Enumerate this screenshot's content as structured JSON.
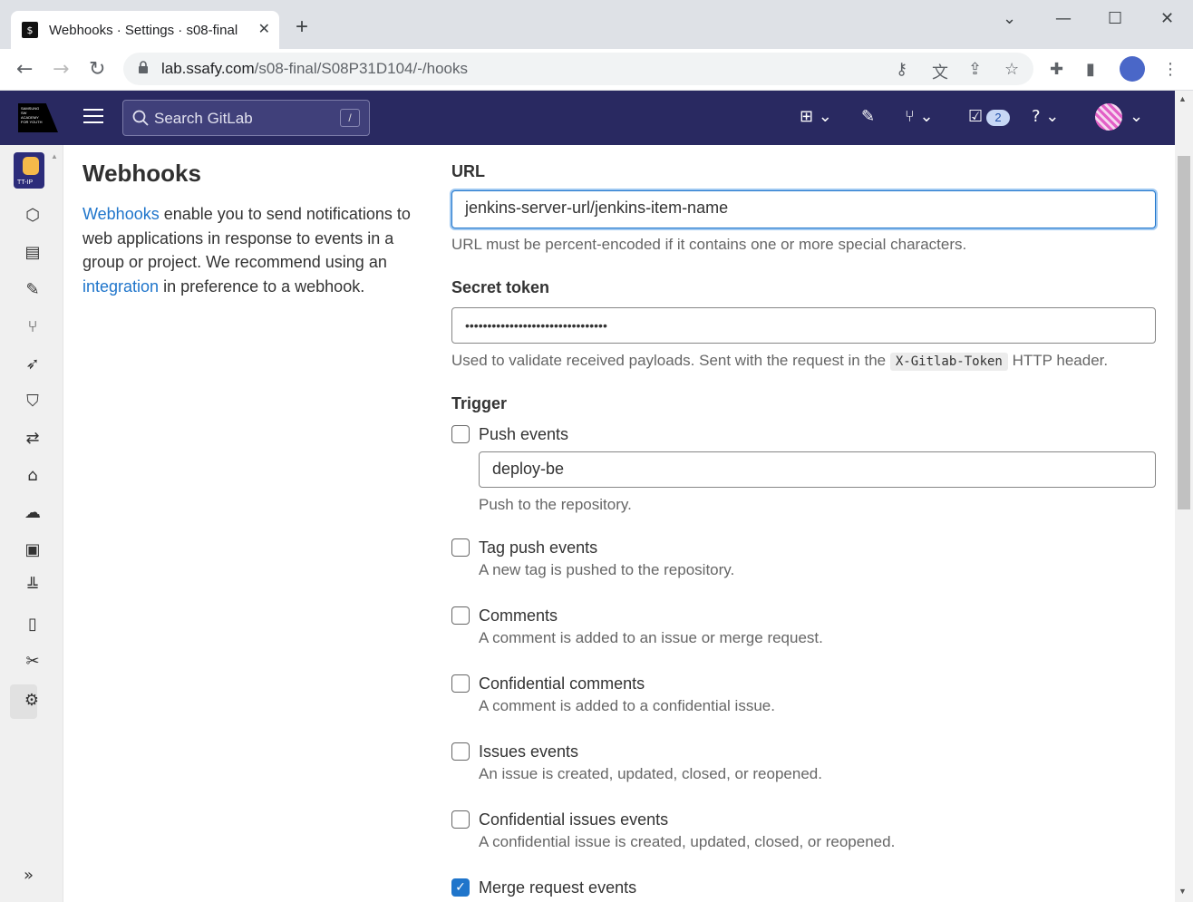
{
  "browser": {
    "tab_title": "Webhooks · Settings · s08-final",
    "tab_favicon_letter": "$",
    "url_host": "lab.ssafy.com",
    "url_path": "/s08-final/S08P31D104/-/hooks"
  },
  "header": {
    "search_placeholder": "Search GitLab",
    "search_shortcut": "/",
    "todo_count": "2",
    "logo_text": "SAMSUNG SW ACADEMY FOR YOUTH"
  },
  "sidebar": {
    "project_avatar_text": "TT-IP",
    "icons": [
      "project-overview-icon",
      "repository-icon",
      "issues-icon",
      "merge-requests-icon",
      "ci-cd-icon",
      "security-icon",
      "deployments-icon",
      "packages-icon",
      "infrastructure-icon",
      "monitor-icon",
      "analytics-icon",
      "wiki-icon",
      "snippets-icon",
      "settings-icon"
    ]
  },
  "intro": {
    "title": "Webhooks",
    "link_webhooks": "Webhooks",
    "text_1": " enable you to send notifications to web applications in response to events in a group or project. We recommend using an ",
    "link_integration": "integration",
    "text_2": " in preference to a webhook."
  },
  "form": {
    "url_label": "URL",
    "url_value": "jenkins-server-url/jenkins-item-name",
    "url_help": "URL must be percent-encoded if it contains one or more special characters.",
    "secret_label": "Secret token",
    "secret_value": "••••••••••••••••••••••••••••••••",
    "secret_help_1": "Used to validate received payloads. Sent with the request in the ",
    "secret_help_code": "X-Gitlab-Token",
    "secret_help_2": " HTTP header.",
    "trigger_label": "Trigger",
    "push_branch_value": "deploy-be",
    "push_help": "Push to the repository.",
    "triggers": [
      {
        "label": "Push events",
        "help": "",
        "checked": false
      },
      {
        "label": "Tag push events",
        "help": "A new tag is pushed to the repository.",
        "checked": false
      },
      {
        "label": "Comments",
        "help": "A comment is added to an issue or merge request.",
        "checked": false
      },
      {
        "label": "Confidential comments",
        "help": "A comment is added to a confidential issue.",
        "checked": false
      },
      {
        "label": "Issues events",
        "help": "An issue is created, updated, closed, or reopened.",
        "checked": false
      },
      {
        "label": "Confidential issues events",
        "help": "A confidential issue is created, updated, closed, or reopened.",
        "checked": false
      },
      {
        "label": "Merge request events",
        "help": "",
        "checked": true
      }
    ]
  }
}
